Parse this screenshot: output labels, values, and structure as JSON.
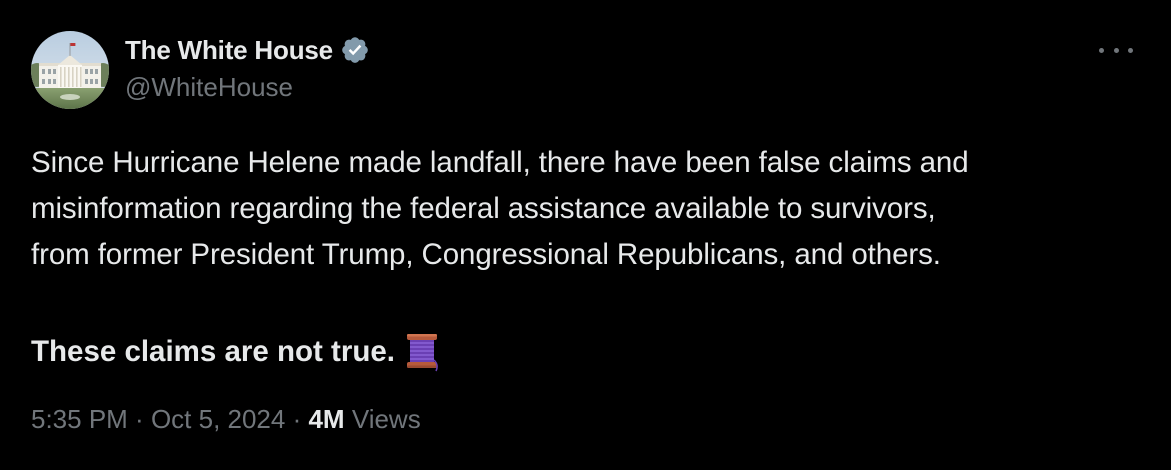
{
  "author": {
    "display_name": "The White House",
    "handle": "@WhiteHouse",
    "verified": true
  },
  "tweet": {
    "text_lines": [
      "Since Hurricane Helene made landfall, there have been false claims and",
      "misinformation regarding the federal assistance available to survivors,",
      "from former President Trump, Congressional Republicans, and others."
    ],
    "emphasis": "These claims are not true.",
    "emoji": "spool-of-thread"
  },
  "meta": {
    "time": "5:35 PM",
    "separator": " · ",
    "date": "Oct 5, 2024",
    "views_count": "4M",
    "views_label": " Views"
  },
  "colors": {
    "background": "#000000",
    "text_primary": "#e7e9ea",
    "text_secondary": "#71767b",
    "verified_badge": "#829aab"
  }
}
